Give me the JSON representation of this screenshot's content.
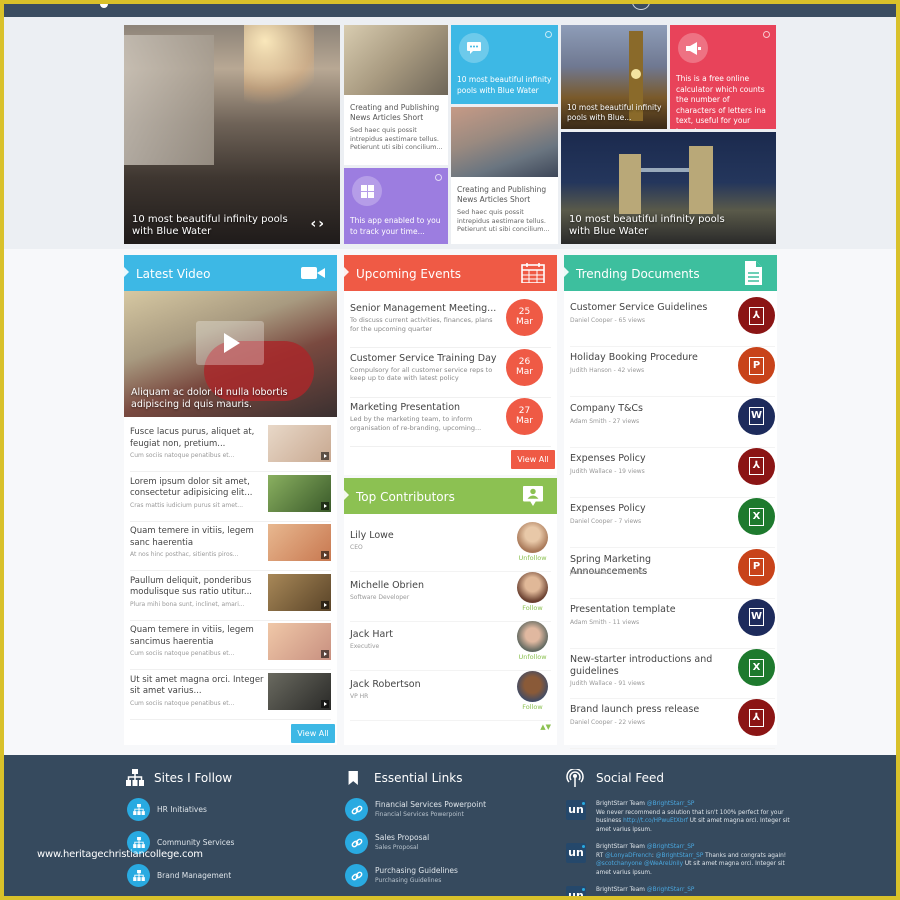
{
  "hero": {
    "main_tile": {
      "caption": "10 most beautiful infinity pools with Blue Water",
      "prev_label": "‹",
      "next_label": "›"
    },
    "news_tile_1": {
      "title": "Creating and Publishing News Articles Short",
      "desc": "Sed haec quis possit intrepidus aestimare tellus. Petierunt uti sibi concilium..."
    },
    "chat_tile": {
      "icon": "chat-bubble-icon",
      "text": "10 most beautiful infinity pools with Blue Water",
      "color": "#3db8e5"
    },
    "windows_tile": {
      "icon": "windows-icon",
      "text": "This app enabled to you to track your time...",
      "color": "#9c7de0"
    },
    "news_tile_2": {
      "title": "Creating and Publishing News Articles Short",
      "desc": "Sed haec quis possit intrepidus aestimare tellus. Petierunt uti sibi concilium..."
    },
    "bigben_tile": {
      "caption": "10 most beautiful infinity pools with Blue..."
    },
    "megaphone_tile": {
      "icon": "megaphone-icon",
      "text": "This is a free online calculator which counts the number of characters of letters ina text, useful for your tweets on...",
      "color": "#e8435a"
    },
    "bridge_tile": {
      "caption": "10 most beautiful infinity pools with Blue Water"
    }
  },
  "latest_video": {
    "title": "Latest Video",
    "color": "#3db8e5",
    "featured_caption": "Aliquam ac dolor id nulla lobortis adipiscing id quis mauris.",
    "items": [
      {
        "title": "Fusce lacus purus, aliquet at, feugiat non, pretium...",
        "sub": "Cum sociis natoque penatibus et..."
      },
      {
        "title": "Lorem ipsum dolor sit amet, consectetur adipisicing elit...",
        "sub": "Cras mattis iudicium purus sit amet..."
      },
      {
        "title": "Quam temere in vitiis, legem sanc haerentia",
        "sub": "At nos hinc posthac, sitientis piros..."
      },
      {
        "title": "Paullum deliquit, ponderibus modulisque sus ratio utitur...",
        "sub": "Plura mihi bona sunt, inclinet, amari..."
      },
      {
        "title": "Quam temere in vitiis, legem sancimus haerentia",
        "sub": "Cum sociis natoque penatibus et..."
      },
      {
        "title": "Ut sit amet magna orci. Integer sit amet varius...",
        "sub": "Cum sociis natoque penatibus et..."
      }
    ],
    "view_all": "View All"
  },
  "upcoming_events": {
    "title": "Upcoming Events",
    "color": "#ef5a45",
    "items": [
      {
        "title": "Senior Management Meeting...",
        "desc": "To discuss current activities, finances, plans for the upcoming quarter",
        "day": "25",
        "month": "Mar"
      },
      {
        "title": "Customer Service Training Day",
        "desc": "Compulsory for all customer service reps to keep up to date with latest policy",
        "day": "26",
        "month": "Mar"
      },
      {
        "title": "Marketing Presentation",
        "desc": "Led by the marketing team, to inform organisation of re-branding, upcoming...",
        "day": "27",
        "month": "Mar"
      }
    ],
    "view_all": "View All"
  },
  "top_contributors": {
    "title": "Top Contributors",
    "color": "#8cc152",
    "items": [
      {
        "name": "Lily Lowe",
        "role": "CEO",
        "action": "Unfollow"
      },
      {
        "name": "Michelle Obrien",
        "role": "Software Developer",
        "action": "Follow"
      },
      {
        "name": "Jack Hart",
        "role": "Executive",
        "action": "Unfollow"
      },
      {
        "name": "Jack Robertson",
        "role": "VP HR",
        "action": "Follow"
      }
    ],
    "scroll_up": "▲",
    "scroll_down": "▼"
  },
  "trending_documents": {
    "title": "Trending Documents",
    "color": "#3dbf9e",
    "items": [
      {
        "title": "Customer Service Guidelines",
        "meta": "Daniel Cooper  - 65 views",
        "type": "pdf",
        "glyph": "⅄"
      },
      {
        "title": "Holiday Booking Procedure",
        "meta": "Judith Hanson - 42 views",
        "type": "ppt",
        "glyph": "P"
      },
      {
        "title": "Company T&Cs",
        "meta": "Adam Smith - 27 views",
        "type": "word",
        "glyph": "W"
      },
      {
        "title": "Expenses Policy",
        "meta": "Judith Wallace - 19 views",
        "type": "pdf",
        "glyph": "⅄"
      },
      {
        "title": "Expenses Policy",
        "meta": "Daniel Cooper - 7 views",
        "type": "excel",
        "glyph": "X"
      },
      {
        "title": "Spring Marketing Announcements",
        "meta": "Judith Hanson - 52 views",
        "type": "ppt",
        "glyph": "P"
      },
      {
        "title": "Presentation template",
        "meta": "Adam Smith - 11 views",
        "type": "word",
        "glyph": "W"
      },
      {
        "title": "New-starter introductions and guidelines",
        "meta": "Judith Wallace - 91 views",
        "type": "excel",
        "glyph": "X"
      },
      {
        "title": "Brand launch press release",
        "meta": "Daniel Cooper - 22 views",
        "type": "pdf",
        "glyph": "⅄"
      }
    ],
    "type_colors": {
      "pdf": "#8b1515",
      "ppt": "#c8431a",
      "word": "#1d2b5c",
      "excel": "#1e7a2e"
    }
  },
  "footer": {
    "sites": {
      "title": "Sites I Follow",
      "items": [
        "HR Initiatives",
        "Community Services",
        "Brand Management"
      ]
    },
    "links": {
      "title": "Essential Links",
      "items": [
        {
          "title": "Financial Services Powerpoint",
          "sub": "Financial Services Powerpoint"
        },
        {
          "title": "Sales Proposal",
          "sub": "Sales Proposal"
        },
        {
          "title": "Purchasing Guidelines",
          "sub": "Purchasing Guidelines"
        }
      ]
    },
    "social": {
      "title": "Social Feed",
      "tweets": [
        {
          "author": "BrightStarr Team",
          "handle": "@BrightStarr_SP",
          "pre": "We never recommend a solution that isn't 100% perfect for your business ",
          "link": "http://t.co/HPwuEtXbrf",
          "post": " Ut sit amet magna orci. Integer sit amet varius ipsum."
        },
        {
          "author": "BrightStarr Team",
          "handle": "@BrightStarr_SP",
          "pre": "RT ",
          "link": "@LonyaDFrench",
          "mid": ": ",
          "link2": "@BrightStarr_SP",
          "mid2": " Thanks and congrats again! ",
          "link3": "@scotchanyone @WeAreUnily",
          "post": " Ut sit amet magna orci. Integer sit amet varius ipsum."
        },
        {
          "author": "BrightStarr Team",
          "handle": "@BrightStarr_SP"
        }
      ]
    }
  },
  "watermark": "www.heritagechristiancollege.com"
}
